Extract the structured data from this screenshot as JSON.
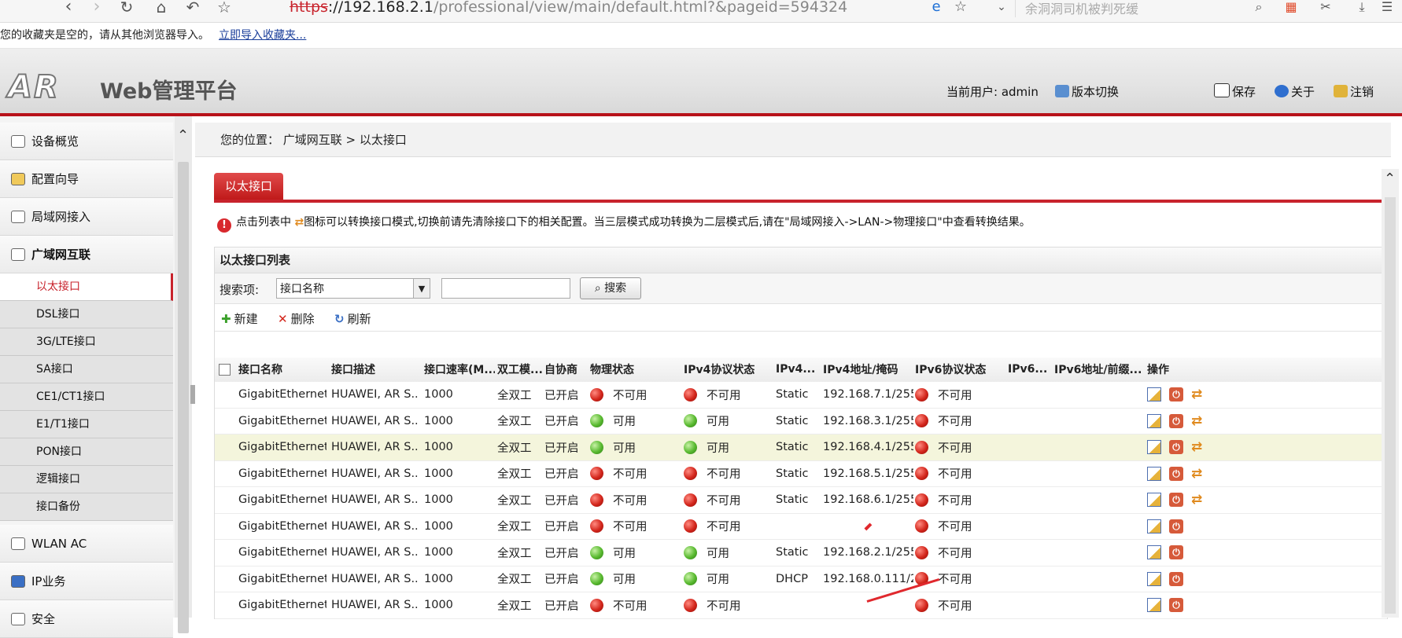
{
  "browser": {
    "address_scheme": "https",
    "address_host": "://192.168.2.1",
    "address_path": "/professional/view/main/default.html?&pageid=594324",
    "search_placeholder": "余洞洞司机被判死缓",
    "bookmark_notice": "您的收藏夹是空的，请从其他浏览器导入。",
    "bookmark_import_link": "立即导入收藏夹..."
  },
  "header": {
    "logo_text": "AR",
    "platform_title": "Web管理平台",
    "current_user": "当前用户: admin",
    "version_switch": "版本切换",
    "save": "保存",
    "about": "关于",
    "logout": "注销"
  },
  "sidebar": {
    "groups": [
      {
        "label": "设备概览",
        "icon": "device-overview-icon"
      },
      {
        "label": "配置向导",
        "icon": "config-wizard-icon"
      },
      {
        "label": "局域网接入",
        "icon": "lan-access-icon"
      },
      {
        "label": "广域网互联",
        "icon": "wan-interconnect-icon"
      }
    ],
    "subitems": [
      "以太接口",
      "DSL接口",
      "3G/LTE接口",
      "SA接口",
      "CE1/CT1接口",
      "E1/T1接口",
      "PON接口",
      "逻辑接口",
      "接口备份"
    ],
    "groups_after": [
      {
        "label": "WLAN AC",
        "icon": "wlan-icon"
      },
      {
        "label": "IP业务",
        "icon": "ip-service-icon"
      },
      {
        "label": "安全",
        "icon": "security-icon"
      }
    ]
  },
  "content": {
    "breadcrumb": "您的位置： 广域网互联 > 以太接口",
    "tab_label": "以太接口",
    "tip_prefix": "点击列表中",
    "tip_suffix": "图标可以转换接口模式,切换前请先清除接口下的相关配置。当三层模式成功转换为二层模式后,请在\"局域网接入->LAN->物理接口\"中查看转换结果。",
    "list_title": "以太接口列表",
    "search_label": "搜索项:",
    "search_field_value": "接口名称",
    "search_input_value": "",
    "search_button": "搜索",
    "toolbar": {
      "new": "新建",
      "delete": "删除",
      "refresh": "刷新"
    }
  },
  "table": {
    "headers": [
      "接口名称",
      "接口描述",
      "接口速率(M...",
      "双工模...",
      "自协商",
      "物理状态",
      "IPv4协议状态",
      "IPv4...",
      "IPv4地址/掩码",
      "IPv6协议状态",
      "IPv6...",
      "IPv6地址/前缀...",
      "操作"
    ],
    "rows": [
      {
        "name": "GigabitEthernet...",
        "desc": "HUAWEI, AR S...",
        "speed": "1000",
        "duplex": "全双工",
        "auto": "已开启",
        "phy": "不可用",
        "phy_ok": false,
        "v4": "不可用",
        "v4_ok": false,
        "v4type": "Static",
        "v4addr": "192.168.7.1/255...",
        "v6": "不可用",
        "v6_ok": false,
        "switch": true
      },
      {
        "name": "GigabitEthernet...",
        "desc": "HUAWEI, AR S...",
        "speed": "1000",
        "duplex": "全双工",
        "auto": "已开启",
        "phy": "可用",
        "phy_ok": true,
        "v4": "可用",
        "v4_ok": true,
        "v4type": "Static",
        "v4addr": "192.168.3.1/255...",
        "v6": "不可用",
        "v6_ok": false,
        "switch": true
      },
      {
        "name": "GigabitEthernet...",
        "desc": "HUAWEI, AR S...",
        "speed": "1000",
        "duplex": "全双工",
        "auto": "已开启",
        "phy": "可用",
        "phy_ok": true,
        "v4": "可用",
        "v4_ok": true,
        "v4type": "Static",
        "v4addr": "192.168.4.1/255...",
        "v6": "不可用",
        "v6_ok": false,
        "switch": true,
        "highlight": true
      },
      {
        "name": "GigabitEthernet...",
        "desc": "HUAWEI, AR S...",
        "speed": "1000",
        "duplex": "全双工",
        "auto": "已开启",
        "phy": "不可用",
        "phy_ok": false,
        "v4": "不可用",
        "v4_ok": false,
        "v4type": "Static",
        "v4addr": "192.168.5.1/255...",
        "v6": "不可用",
        "v6_ok": false,
        "switch": true
      },
      {
        "name": "GigabitEthernet...",
        "desc": "HUAWEI, AR S...",
        "speed": "1000",
        "duplex": "全双工",
        "auto": "已开启",
        "phy": "不可用",
        "phy_ok": false,
        "v4": "不可用",
        "v4_ok": false,
        "v4type": "Static",
        "v4addr": "192.168.6.1/255...",
        "v6": "不可用",
        "v6_ok": false,
        "switch": true
      },
      {
        "name": "GigabitEthernet...",
        "desc": "HUAWEI, AR S...",
        "speed": "1000",
        "duplex": "全双工",
        "auto": "已开启",
        "phy": "不可用",
        "phy_ok": false,
        "v4": "不可用",
        "v4_ok": false,
        "v4type": "",
        "v4addr": "",
        "v6": "不可用",
        "v6_ok": false,
        "switch": false
      },
      {
        "name": "GigabitEthernet...",
        "desc": "HUAWEI, AR S...",
        "speed": "1000",
        "duplex": "全双工",
        "auto": "已开启",
        "phy": "可用",
        "phy_ok": true,
        "v4": "可用",
        "v4_ok": true,
        "v4type": "Static",
        "v4addr": "192.168.2.1/255...",
        "v6": "不可用",
        "v6_ok": false,
        "switch": false
      },
      {
        "name": "GigabitEthernet...",
        "desc": "HUAWEI, AR S...",
        "speed": "1000",
        "duplex": "全双工",
        "auto": "已开启",
        "phy": "可用",
        "phy_ok": true,
        "v4": "可用",
        "v4_ok": true,
        "v4type": "DHCP",
        "v4addr": "192.168.0.111/2...",
        "v6": "不可用",
        "v6_ok": false,
        "switch": false
      },
      {
        "name": "GigabitEthernet...",
        "desc": "HUAWEI, AR S...",
        "speed": "1000",
        "duplex": "全双工",
        "auto": "已开启",
        "phy": "不可用",
        "phy_ok": false,
        "v4": "不可用",
        "v4_ok": false,
        "v4type": "",
        "v4addr": "",
        "v6": "不可用",
        "v6_ok": false,
        "switch": false
      }
    ]
  },
  "colors": {
    "brand_red": "#c8232c",
    "status_green": "#58b92f",
    "status_red": "#d3261c",
    "highlight_row": "#f4f5dc"
  }
}
